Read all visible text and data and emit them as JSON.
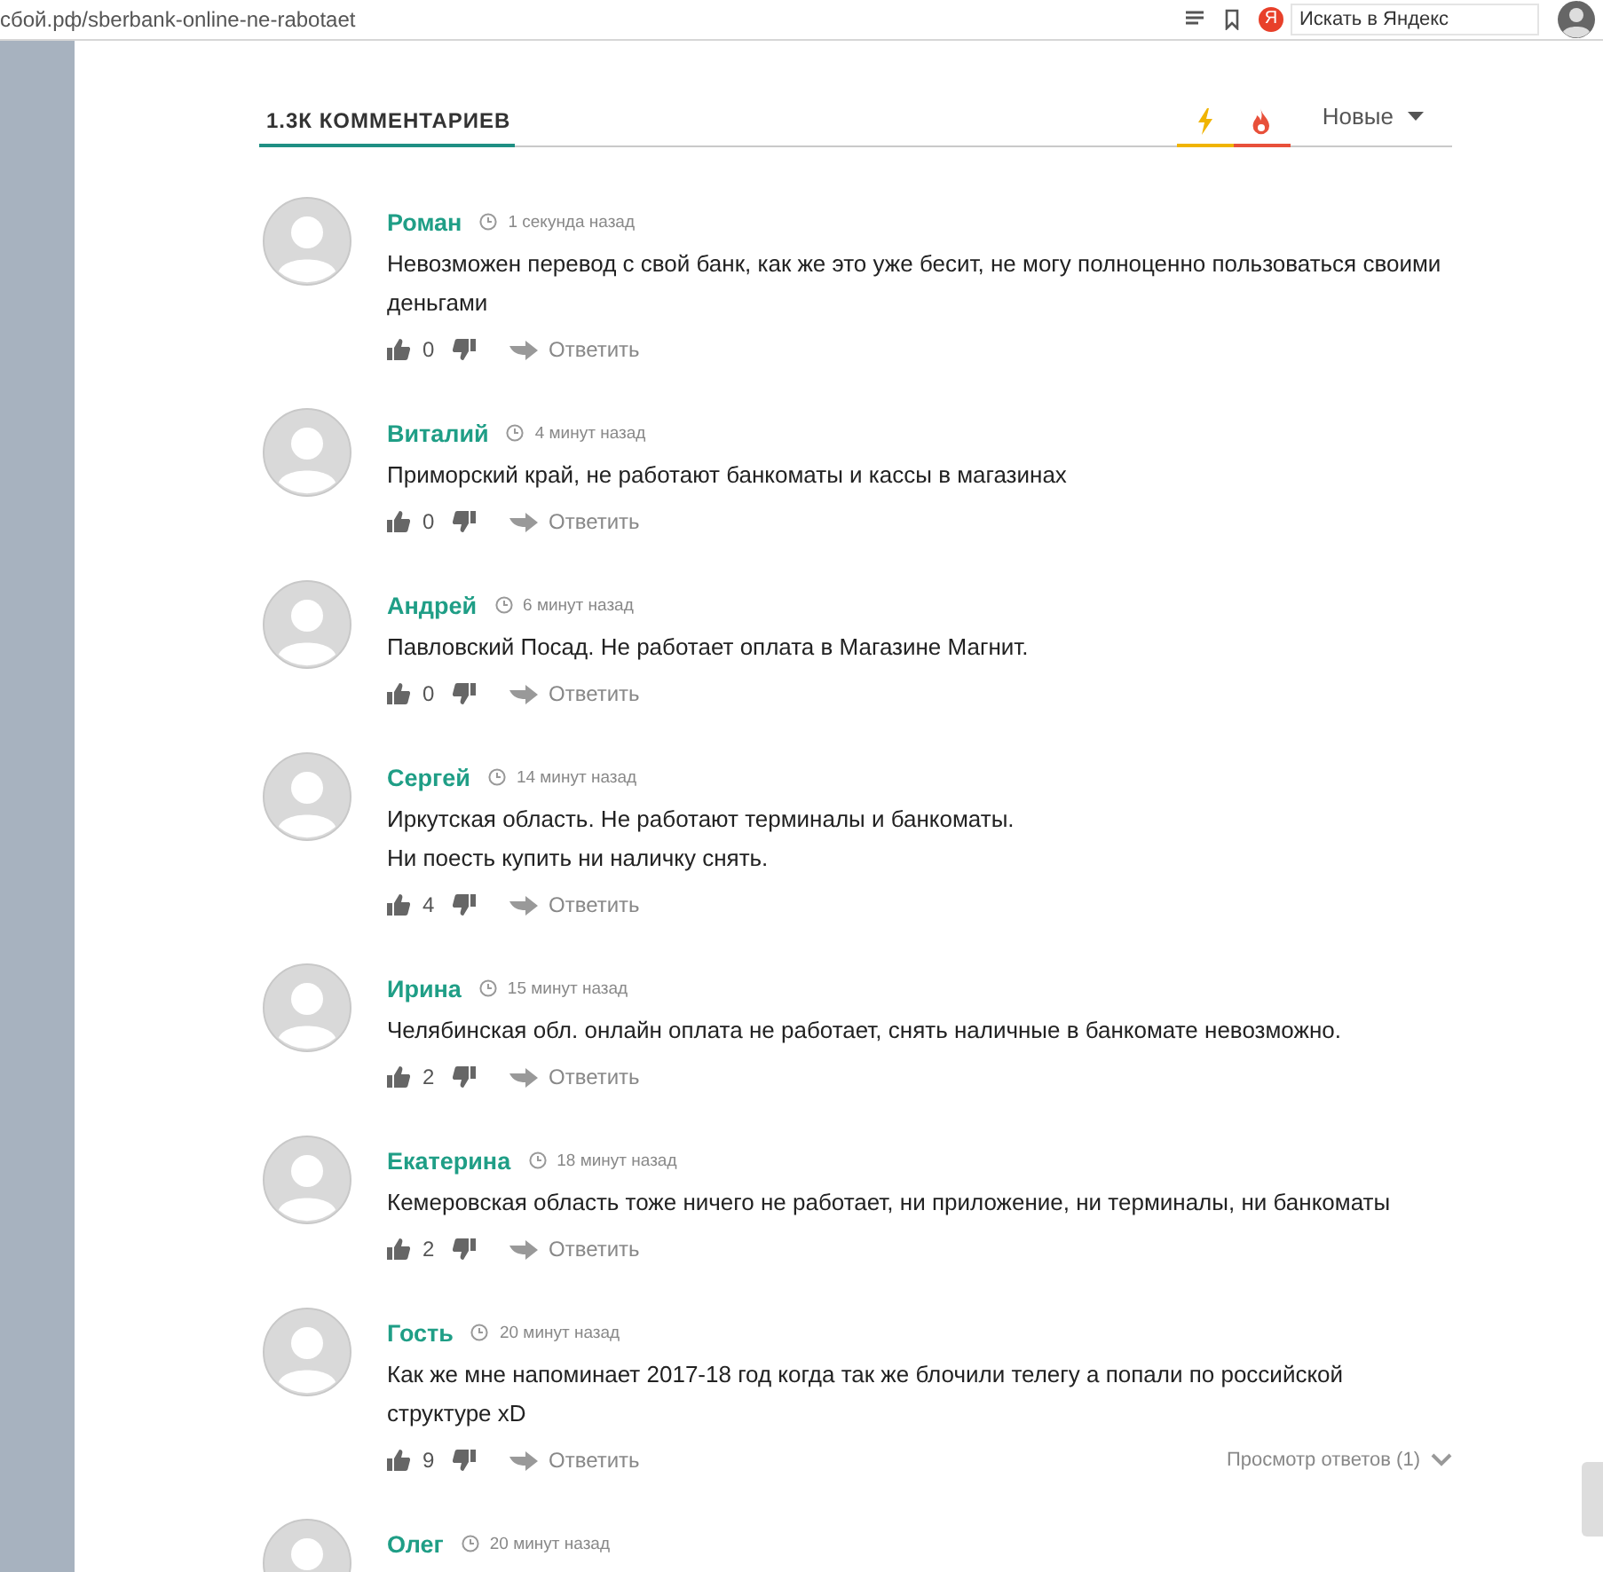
{
  "browser": {
    "url": "сбой.рф/sberbank-online-ne-rabotaet",
    "search": {
      "logo_letter": "Я",
      "placeholder": "Искать в Яндекс"
    }
  },
  "comments_header": {
    "title": "1.3К КОММЕНТАРИЕВ",
    "sort_tabs": [
      {
        "kind": "lightning",
        "color": "#f0b400"
      },
      {
        "kind": "fire",
        "color": "#e8503a"
      }
    ],
    "sort": "Новые"
  },
  "comments": [
    {
      "author": "Роман",
      "time": "1 секунда назад",
      "text": "Невозможен перевод с свой банк, как же это уже бесит, не могу полноценно пользоваться своими деньгами",
      "likes": "0",
      "reply": "Ответить"
    },
    {
      "author": "Виталий",
      "time": "4 минут назад",
      "text": "Приморский край, не работают банкоматы и кассы в магазинах",
      "likes": "0",
      "reply": "Ответить"
    },
    {
      "author": "Андрей",
      "time": "6 минут назад",
      "text": "Павловский Посад. Не работает оплата в Магазине Магнит.",
      "likes": "0",
      "reply": "Ответить"
    },
    {
      "author": "Сергей",
      "time": "14 минут назад",
      "text": "Иркутская область. Не работают терминалы и банкоматы.\nНи поесть купить ни наличку снять.",
      "likes": "4",
      "reply": "Ответить"
    },
    {
      "author": "Ирина",
      "time": "15 минут назад",
      "text": "Челябинская обл. онлайн оплата не работает, снять наличные в банкомате невозможно.",
      "likes": "2",
      "reply": "Ответить"
    },
    {
      "author": "Екатерина",
      "time": "18 минут назад",
      "text": "Кемеровская область тоже ничего не работает, ни приложение, ни терминалы, ни банкоматы",
      "likes": "2",
      "reply": "Ответить"
    },
    {
      "author": "Гость",
      "time": "20 минут назад",
      "text": "Как же мне напоминает 2017-18 год когда так же блочили телегу а попали по российской структуре xD",
      "likes": "9",
      "reply": "Ответить",
      "replies_link": "Просмотр ответов (1)"
    },
    {
      "author": "Олег",
      "time": "20 минут назад"
    }
  ]
}
